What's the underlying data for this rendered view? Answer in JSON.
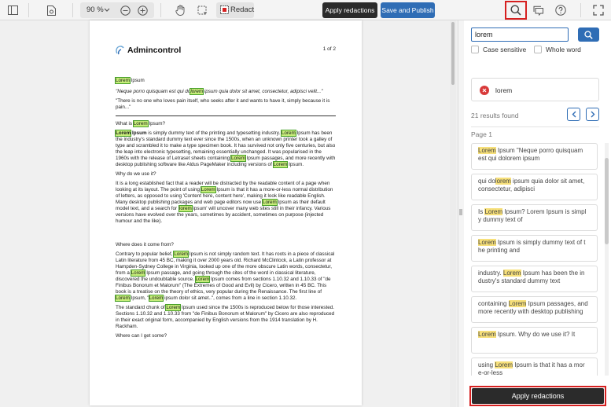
{
  "toolbar": {
    "zoom": "90 %",
    "redact_label": "Redact",
    "apply_label": "Apply redactions",
    "publish_label": "Save and Publish"
  },
  "document": {
    "logo_text": "Admincontrol",
    "page_indicator": "1 of 2",
    "heading1": [
      [
        "hl",
        "Lorem"
      ],
      [
        "t",
        " Ipsum"
      ]
    ],
    "quote": [
      [
        "t",
        "\"Neque porro quisquam est qui do"
      ],
      [
        "hl",
        "lorem"
      ],
      [
        "t",
        " ipsum quia dolor sit amet, consectetur, adipisci velit...\""
      ]
    ],
    "quote2": "\"There is no one who loves pain itself, who seeks after it and wants to have it, simply because it is pain...\"",
    "q1": [
      [
        "t",
        "What is "
      ],
      [
        "hl",
        "Lorem"
      ],
      [
        "t",
        " Ipsum?"
      ]
    ],
    "p1": [
      [
        "b",
        "Lorem"
      ],
      [
        "bt",
        " Ipsum"
      ],
      [
        "t",
        " is simply dummy text of the printing and typesetting industry. "
      ],
      [
        "hl",
        "Lorem"
      ],
      [
        "t",
        " Ipsum has been the industry's standard dummy text ever since the 1500s, when an unknown printer took a galley of type and scrambled it to make a type specimen book. It has survived not only five centuries, but also the leap into electronic typesetting, remaining essentially unchanged. It was popularised in the 1960s with the release of Letraset sheets containing "
      ],
      [
        "hl",
        "Lorem"
      ],
      [
        "t",
        " Ipsum passages, and more recently with desktop publishing software like Aldus PageMaker including versions of "
      ],
      [
        "hl",
        "Lorem"
      ],
      [
        "t",
        " Ipsum."
      ]
    ],
    "q2": "Why do we use it?",
    "p2": [
      [
        "t",
        "It is a long established fact that a reader will be distracted by the readable content of a page when looking at its layout. The point of using "
      ],
      [
        "hl",
        "Lorem"
      ],
      [
        "t",
        " Ipsum is that it has a more-or-less normal distribution of letters, as opposed to using 'Content here, content here', making it look like readable English. Many desktop publishing packages and web page editors now use "
      ],
      [
        "hl",
        "Lorem"
      ],
      [
        "t",
        " Ipsum as their default model text, and a search for '"
      ],
      [
        "hl",
        "lorem"
      ],
      [
        "t",
        " ipsum' will uncover many web sites still in their infancy. Various versions have evolved over the years, sometimes by accident, sometimes on purpose (injected humour and the like)."
      ]
    ],
    "q3": "Where does it come from?",
    "p3": [
      [
        "t",
        "Contrary to popular belief, "
      ],
      [
        "hl",
        "Lorem"
      ],
      [
        "t",
        " Ipsum is not simply random text. It has roots in a piece of classical Latin literature from 45 BC, making it over 2000 years old. Richard McClintock, a Latin professor at Hampden-Sydney College in Virginia, looked up one of the more obscure Latin words, consectetur, from a "
      ],
      [
        "hl",
        "Lorem"
      ],
      [
        "t",
        " Ipsum passage, and going through the cites of the word in classical literature, discovered the undoubtable source. "
      ],
      [
        "hl",
        "Lorem"
      ],
      [
        "t",
        " Ipsum comes from sections 1.10.32 and 1.10.33 of \"de Finibus Bonorum et Malorum\" (The Extremes of Good and Evil) by Cicero, written in 45 BC. This book is a treatise on the theory of ethics, very popular during the Renaissance. The first line of "
      ],
      [
        "hl",
        "Lorem"
      ],
      [
        "t",
        " Ipsum, \""
      ],
      [
        "hl",
        "Lorem"
      ],
      [
        "t",
        " ipsum dolor sit amet..\", comes from a line in section 1.10.32."
      ]
    ],
    "p4": [
      [
        "t",
        "The standard chunk of "
      ],
      [
        "hl",
        "Lorem"
      ],
      [
        "t",
        " Ipsum used since the 1500s is reproduced below for those interested. Sections 1.10.32 and 1.10.33 from \"de Finibus Bonorum et Malorum\" by Cicero are also reproduced in their exact original form, accompanied by English versions from the 1914 translation by H. Rackham."
      ]
    ],
    "q4": "Where can I get some?"
  },
  "search": {
    "value": "lorem",
    "case_sensitive_label": "Case sensitive",
    "whole_word_label": "Whole word",
    "term": "lorem",
    "results_found": "21 results found",
    "page_label": "Page 1",
    "results": [
      [
        [
          "h",
          "Lorem"
        ],
        [
          "t",
          " Ipsum \"Neque porro quisquam est qui dolorem ipsum"
        ]
      ],
      [
        [
          "t",
          "qui do"
        ],
        [
          "h",
          "lorem"
        ],
        [
          "t",
          " ipsum quia dolor sit amet, consectetur, adipisci"
        ]
      ],
      [
        [
          "t",
          "Is "
        ],
        [
          "h",
          "Lorem"
        ],
        [
          "t",
          " Ipsum? Lorem Ipsum is simpl y dummy text of"
        ]
      ],
      [
        [
          "h",
          "Lorem"
        ],
        [
          "t",
          " Ipsum is simply dummy text of t he printing and"
        ]
      ],
      [
        [
          "t",
          "industry. "
        ],
        [
          "h",
          "Lorem"
        ],
        [
          "t",
          " Ipsum has been the in dustry's standard dummy text"
        ]
      ],
      [
        [
          "t",
          "containing "
        ],
        [
          "h",
          "Lorem"
        ],
        [
          "t",
          " Ipsum passages, and more recently with desktop publishing"
        ]
      ],
      [
        [
          "h",
          "Lorem"
        ],
        [
          "t",
          " Ipsum. Why do we use it? It"
        ]
      ],
      [
        [
          "t",
          "using "
        ],
        [
          "h",
          "Lorem"
        ],
        [
          "t",
          " Ipsum is that it has a mor e-or-less"
        ]
      ]
    ],
    "apply_label": "Apply redactions"
  }
}
